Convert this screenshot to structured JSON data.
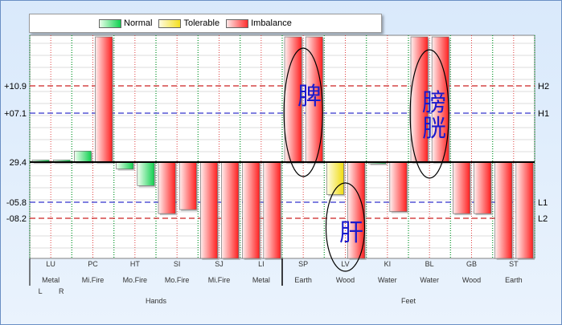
{
  "legend": {
    "items": [
      {
        "label": "Normal",
        "color": "#10d050"
      },
      {
        "label": "Tolerable",
        "color": "#f4e020"
      },
      {
        "label": "Imbalance",
        "color": "#ff3030"
      }
    ]
  },
  "chart_data": {
    "type": "bar",
    "title": "",
    "baseline": 29.4,
    "ylim": [
      -8.9,
      14.5
    ],
    "reference_lines": [
      {
        "label": "H2",
        "value": 10.9,
        "tick": "+10.9",
        "color": "#cc2222"
      },
      {
        "label": "H1",
        "value": 7.1,
        "tick": "+07.1",
        "color": "#3333cc"
      },
      {
        "label": "L1",
        "value": -5.8,
        "tick": "-05.8",
        "color": "#3333cc"
      },
      {
        "label": "L2",
        "value": -8.2,
        "tick": "-08.2",
        "color": "#cc2222"
      }
    ],
    "baseline_tick": "29.4",
    "sides": [
      "L",
      "R"
    ],
    "categories": [
      {
        "code": "LU",
        "element": "Metal",
        "L": {
          "v": 0.3,
          "c": "normal"
        },
        "R": {
          "v": 0.3,
          "c": "normal"
        }
      },
      {
        "code": "PC",
        "element": "Mi.Fire",
        "L": {
          "v": 1.6,
          "c": "normal"
        },
        "R": {
          "v": 14.5,
          "c": "imbalance"
        }
      },
      {
        "code": "HT",
        "element": "Mo.Fire",
        "L": {
          "v": -1.0,
          "c": "normal"
        },
        "R": {
          "v": -3.4,
          "c": "normal"
        }
      },
      {
        "code": "SI",
        "element": "Mo.Fire",
        "L": {
          "v": -7.5,
          "c": "imbalance"
        },
        "R": {
          "v": -6.9,
          "c": "imbalance"
        }
      },
      {
        "code": "SJ",
        "element": "Mi.Fire",
        "L": {
          "v": -9.9,
          "c": "imbalance"
        },
        "R": {
          "v": -9.9,
          "c": "imbalance"
        }
      },
      {
        "code": "LI",
        "element": "Metal",
        "L": {
          "v": -9.9,
          "c": "imbalance"
        },
        "R": {
          "v": -9.9,
          "c": "imbalance"
        }
      },
      {
        "code": "SP",
        "element": "Earth",
        "L": {
          "v": 14.5,
          "c": "imbalance"
        },
        "R": {
          "v": 14.5,
          "c": "imbalance"
        }
      },
      {
        "code": "LV",
        "element": "Wood",
        "L": {
          "v": -4.7,
          "c": "tolerable"
        },
        "R": {
          "v": -9.9,
          "c": "imbalance"
        }
      },
      {
        "code": "KI",
        "element": "Water",
        "L": {
          "v": -0.2,
          "c": "normal"
        },
        "R": {
          "v": -7.2,
          "c": "imbalance"
        }
      },
      {
        "code": "BL",
        "element": "Water",
        "L": {
          "v": 14.5,
          "c": "imbalance"
        },
        "R": {
          "v": 14.5,
          "c": "imbalance"
        }
      },
      {
        "code": "GB",
        "element": "Wood",
        "L": {
          "v": -7.5,
          "c": "imbalance"
        },
        "R": {
          "v": -7.5,
          "c": "imbalance"
        }
      },
      {
        "code": "ST",
        "element": "Earth",
        "L": {
          "v": -9.9,
          "c": "imbalance"
        },
        "R": {
          "v": -9.9,
          "c": "imbalance"
        }
      }
    ],
    "groups": [
      {
        "label": "Hands",
        "from": 0,
        "to": 5
      },
      {
        "label": "Feet",
        "from": 6,
        "to": 11
      }
    ],
    "annotations": [
      {
        "text": "脾",
        "category": 6
      },
      {
        "text": "肝",
        "category": 7
      },
      {
        "text": "膀胱",
        "category": 9
      }
    ]
  }
}
